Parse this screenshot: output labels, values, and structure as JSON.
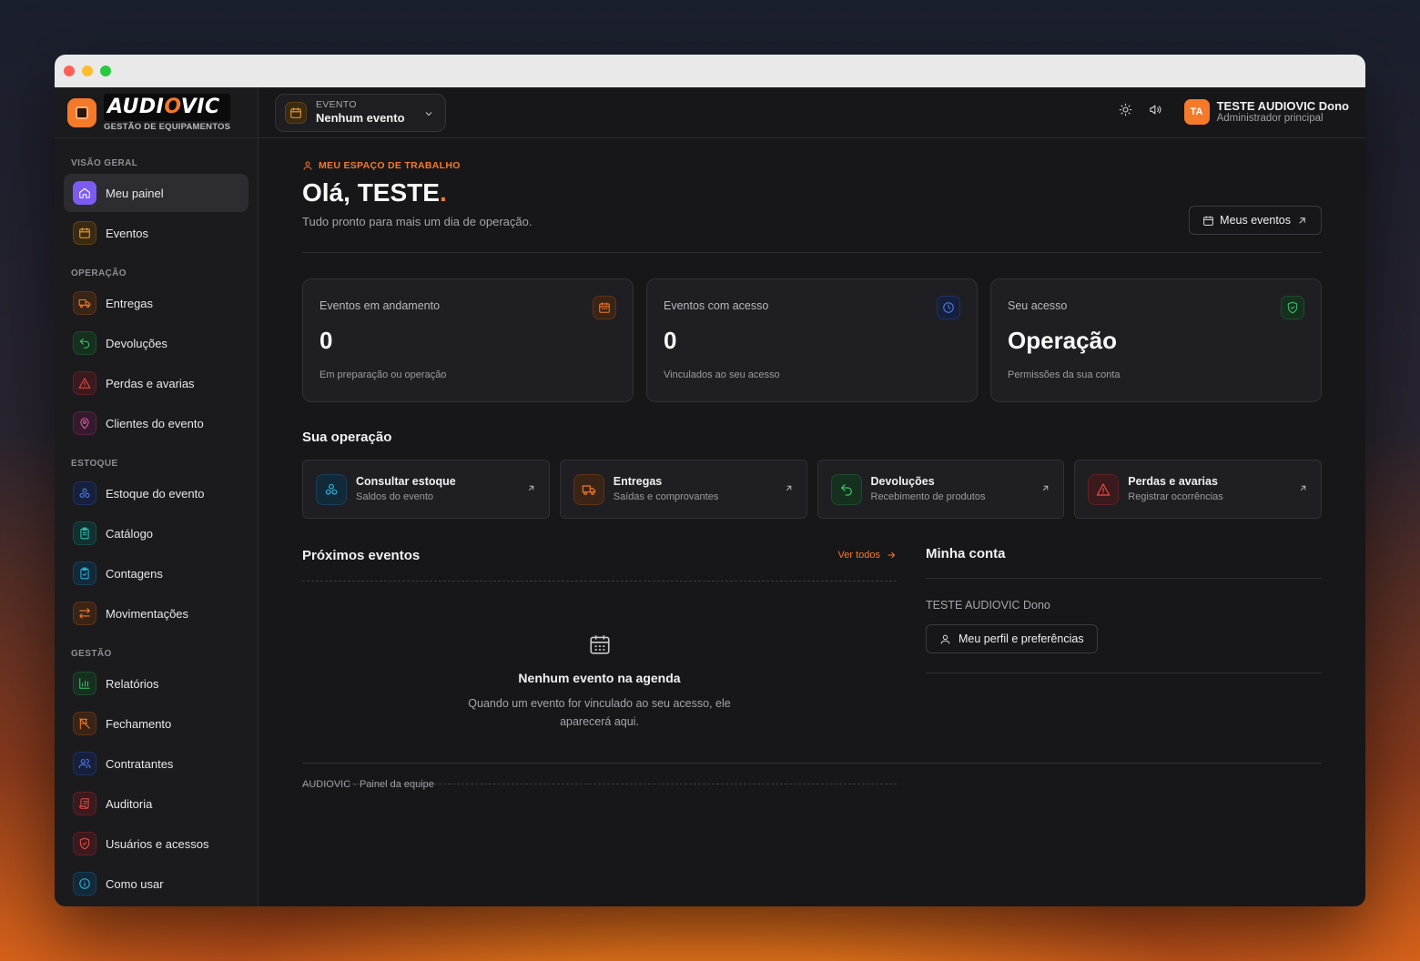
{
  "brand": {
    "logo_prefix": "AUDI",
    "logo_o": "O",
    "logo_suffix": "VIC",
    "subtitle": "GESTÃO DE EQUIPAMENTOS"
  },
  "sidebar": {
    "sections": [
      {
        "label": "VISÃO GERAL",
        "items": [
          {
            "label": "Meu painel",
            "icon": "home-icon",
            "active": true
          },
          {
            "label": "Eventos",
            "icon": "calendar-icon"
          }
        ]
      },
      {
        "label": "OPERAÇÃO",
        "items": [
          {
            "label": "Entregas",
            "icon": "truck-icon"
          },
          {
            "label": "Devoluções",
            "icon": "return-icon"
          },
          {
            "label": "Perdas e avarias",
            "icon": "warning-icon"
          },
          {
            "label": "Clientes do evento",
            "icon": "map-pin-icon"
          }
        ]
      },
      {
        "label": "ESTOQUE",
        "items": [
          {
            "label": "Estoque do evento",
            "icon": "boxes-icon"
          },
          {
            "label": "Catálogo",
            "icon": "clipboard-icon"
          },
          {
            "label": "Contagens",
            "icon": "clipboard-check-icon"
          },
          {
            "label": "Movimentações",
            "icon": "swap-icon"
          }
        ]
      },
      {
        "label": "GESTÃO",
        "items": [
          {
            "label": "Relatórios",
            "icon": "bar-chart-icon"
          },
          {
            "label": "Fechamento",
            "icon": "flag-off-icon"
          },
          {
            "label": "Contratantes",
            "icon": "users-icon"
          },
          {
            "label": "Auditoria",
            "icon": "scroll-icon"
          },
          {
            "label": "Usuários e acessos",
            "icon": "shield-icon"
          },
          {
            "label": "Como usar",
            "icon": "info-icon"
          }
        ]
      }
    ]
  },
  "topbar": {
    "event_label": "EVENTO",
    "event_value": "Nenhum evento",
    "user_initials": "TA",
    "user_name": "TESTE AUDIOVIC Dono",
    "user_role": "Administrador principal"
  },
  "header": {
    "workspace": "MEU ESPAÇO DE TRABALHO",
    "greeting": "Olá, TESTE",
    "greeting_dot": ".",
    "subtitle": "Tudo pronto para mais um dia de operação.",
    "my_events_button": "Meus eventos"
  },
  "stats": [
    {
      "label": "Eventos em andamento",
      "value": "0",
      "note": "Em preparação ou operação",
      "icon": "calendar-icon"
    },
    {
      "label": "Eventos com acesso",
      "value": "0",
      "note": "Vinculados ao seu acesso",
      "icon": "clock-icon"
    },
    {
      "label": "Seu acesso",
      "value": "Operação",
      "note": "Permissões da sua conta",
      "icon": "shield-check-icon"
    }
  ],
  "operations": {
    "title": "Sua operação",
    "items": [
      {
        "title": "Consultar estoque",
        "sub": "Saldos do evento",
        "icon": "boxes-icon"
      },
      {
        "title": "Entregas",
        "sub": "Saídas e comprovantes",
        "icon": "truck-icon"
      },
      {
        "title": "Devoluções",
        "sub": "Recebimento de produtos",
        "icon": "return-icon"
      },
      {
        "title": "Perdas e avarias",
        "sub": "Registrar ocorrências",
        "icon": "warning-icon"
      }
    ]
  },
  "upcoming": {
    "title": "Próximos eventos",
    "see_all": "Ver todos",
    "empty_title": "Nenhum evento na agenda",
    "empty_text": "Quando um evento for vinculado ao seu acesso, ele aparecerá aqui."
  },
  "account": {
    "title": "Minha conta",
    "name": "TESTE AUDIOVIC Dono",
    "profile_button": "Meu perfil e preferências"
  },
  "footer": {
    "text": "AUDIOVIC · Painel da equipe"
  }
}
